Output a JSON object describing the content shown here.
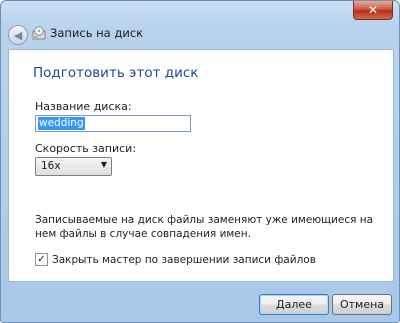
{
  "window": {
    "title": "Запись на диск"
  },
  "titlebar": {
    "close_glyph": "✕",
    "back_glyph": "◀"
  },
  "main": {
    "heading": "Подготовить этот диск",
    "name_label": "Название диска:",
    "name_value": "wedding",
    "speed_label": "Скорость записи:",
    "speed_value": "16x",
    "note": "Записываемые на диск файлы заменяют уже имеющиеся на нем файлы в случае совпадения имен.",
    "close_checkbox_label": "Закрыть мастер по завершении записи файлов",
    "close_checkbox_checked": true
  },
  "buttons": {
    "next": "Далее",
    "cancel": "Отмена"
  }
}
